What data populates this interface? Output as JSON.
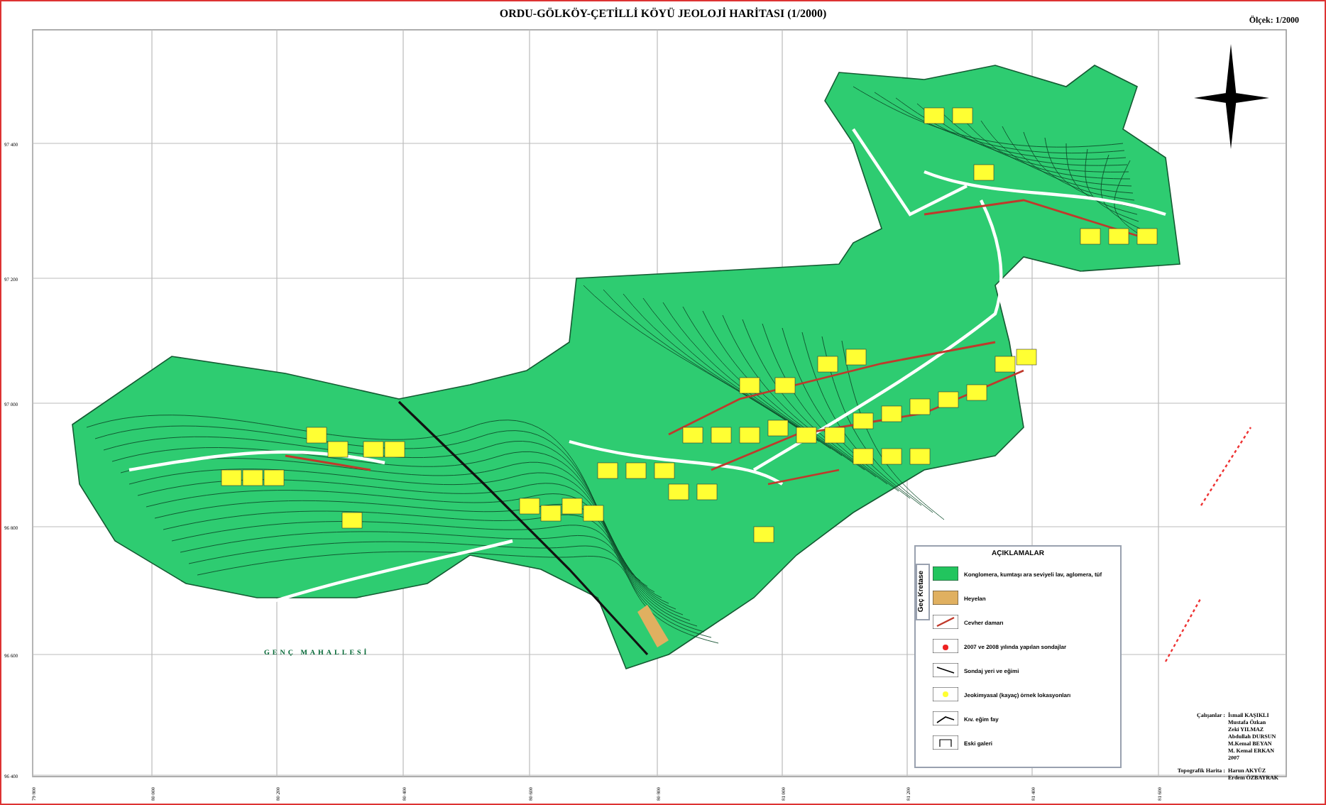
{
  "title": "ORDU-GÖLKÖY-ÇETİLLİ KÖYÜ JEOLOJİ HARİTASI (1/2000)",
  "scale": "Ölçek: 1/2000",
  "map": {
    "place_label": "GENÇ MAHALLESİ",
    "y_labels": [
      "97 400",
      "97 200",
      "97 000",
      "96 800",
      "96 600",
      "96 400"
    ],
    "x_labels": [
      "79 800",
      "80 000",
      "80 200",
      "80 400",
      "80 600",
      "80 800",
      "81 000",
      "81 200",
      "81 400",
      "81 600"
    ]
  },
  "legend": {
    "title": "AÇIKLAMALAR",
    "unit_label": "Geç Kretase",
    "items": [
      {
        "kind": "fill",
        "color": "#22c55e",
        "label": "Konglomera, kumtaşı ara seviyeli lav, aglomera, tüf"
      },
      {
        "kind": "fill",
        "color": "#e0b060",
        "label": "Heyelan"
      },
      {
        "kind": "vein",
        "label": "Cevher damarı"
      },
      {
        "kind": "drill",
        "label": "2007 ve 2008 yılında yapılan sondajlar"
      },
      {
        "kind": "dip",
        "label": "Sondaj yeri ve eğimi"
      },
      {
        "kind": "sample",
        "label": "Jeokimyasal (kayaç) örnek lokasyonları"
      },
      {
        "kind": "fault",
        "label": "Kıv. eğim fay"
      },
      {
        "kind": "gallery",
        "label": "Eski galeri"
      }
    ]
  },
  "credits": {
    "workers_label": "Çalışanlar :",
    "workers": [
      "İsmail KAŞIKLI",
      "Mustafa Özkan",
      "Zeki YILMAZ",
      "Abdullah DURSUN",
      "M.Kemal BEYAN",
      "M. Kemal ERKAN",
      "2007"
    ],
    "topo_label": "Topografik Harita :",
    "topo": [
      "Harun AKYÜZ",
      "Erdem ÖZBAYRAK"
    ]
  }
}
